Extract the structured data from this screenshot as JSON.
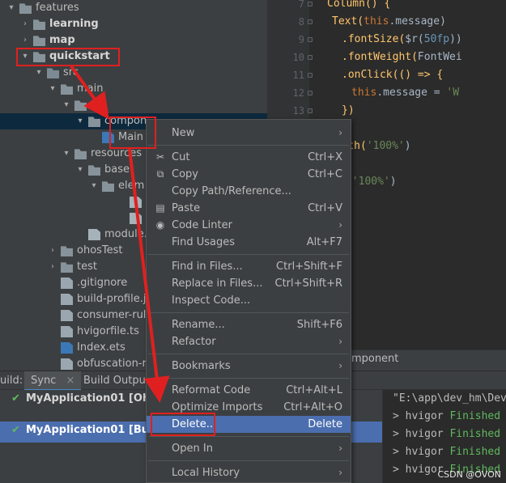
{
  "tree": {
    "rows": [
      {
        "label": "features",
        "type": "folder",
        "chev": "▾",
        "depth": 0
      },
      {
        "label": "learning",
        "type": "module",
        "chev": "›",
        "depth": 1
      },
      {
        "label": "map",
        "type": "module",
        "chev": "›",
        "depth": 1
      },
      {
        "label": "quickstart",
        "type": "module",
        "chev": "▾",
        "depth": 1
      },
      {
        "label": "src",
        "type": "src",
        "chev": "▾",
        "depth": 2
      },
      {
        "label": "main",
        "type": "folder",
        "chev": "▾",
        "depth": 3
      },
      {
        "label": "ets",
        "type": "folder",
        "chev": "▾",
        "depth": 4
      },
      {
        "label": "compon",
        "type": "folder",
        "chev": "▾",
        "depth": 5
      },
      {
        "label": "Main",
        "type": "ets",
        "chev": "",
        "depth": 6
      },
      {
        "label": "resources",
        "type": "folder",
        "chev": "▾",
        "depth": 4
      },
      {
        "label": "base",
        "type": "folder",
        "chev": "▾",
        "depth": 5
      },
      {
        "label": "elem",
        "type": "folder",
        "chev": "▾",
        "depth": 6
      },
      {
        "label": "flo",
        "type": "json",
        "chev": "",
        "depth": 8
      },
      {
        "label": "str",
        "type": "json",
        "chev": "",
        "depth": 8
      },
      {
        "label": "module.jso",
        "type": "json",
        "chev": "",
        "depth": 5
      },
      {
        "label": "ohosTest",
        "type": "folder",
        "chev": "›",
        "depth": 3
      },
      {
        "label": "test",
        "type": "folder",
        "chev": "›",
        "depth": 3
      },
      {
        "label": ".gitignore",
        "type": "file",
        "chev": "",
        "depth": 3
      },
      {
        "label": "build-profile.jso",
        "type": "file",
        "chev": "",
        "depth": 3
      },
      {
        "label": "consumer-rules.t",
        "type": "file",
        "chev": "",
        "depth": 3
      },
      {
        "label": "hvigorfile.ts",
        "type": "file",
        "chev": "",
        "depth": 3
      },
      {
        "label": "Index.ets",
        "type": "ets",
        "chev": "",
        "depth": 3
      },
      {
        "label": "obfuscation-rules",
        "type": "file",
        "chev": "",
        "depth": 3
      }
    ]
  },
  "editor": {
    "line_numbers": [
      "7",
      "8",
      "9",
      "10",
      "11",
      "12",
      "13"
    ],
    "lines": [
      [
        {
          "t": "Column() {",
          "c": "c-y",
          "i": 4
        }
      ],
      [
        {
          "t": "Text(",
          "c": "c-y",
          "i": 5
        },
        {
          "t": "this",
          "c": "c-o"
        },
        {
          "t": ".message)",
          "c": ""
        }
      ],
      [
        {
          "t": ".fontSize(",
          "c": "c-y",
          "i": 7
        },
        {
          "t": "$r(",
          "c": ""
        },
        {
          "t": "50fp",
          "c": "c-b"
        },
        {
          "t": "))",
          "c": ""
        }
      ],
      [
        {
          "t": ".fontWeight(",
          "c": "c-y",
          "i": 7
        },
        {
          "t": "FontWei",
          "c": ""
        }
      ],
      [
        {
          "t": ".onClick(() => {",
          "c": "c-y",
          "i": 7
        }
      ],
      [
        {
          "t": "this",
          "c": "c-o",
          "i": 9
        },
        {
          "t": ".message = ",
          "c": ""
        },
        {
          "t": "'W",
          "c": "c-g"
        }
      ],
      [
        {
          "t": "})",
          "c": "c-y",
          "i": 7
        }
      ],
      [
        {
          "t": "}",
          "c": "c-y",
          "i": 3
        }
      ],
      [
        {
          "t": ".width(",
          "c": "c-y",
          "i": 3
        },
        {
          "t": "'100%'",
          "c": "c-g"
        },
        {
          "t": ")",
          "c": ""
        }
      ],
      [
        {
          "t": "",
          "c": "",
          "i": 0
        }
      ],
      [
        {
          "t": "height(",
          "c": "c-y",
          "i": 0
        },
        {
          "t": "'100%'",
          "c": "c-g"
        },
        {
          "t": ")",
          "c": ""
        }
      ]
    ],
    "breadcrumb_fragment": "omponent"
  },
  "tabs": {
    "build_label": "uild:",
    "sync_label": "Sync",
    "close_glyph": "×",
    "build_output_label": "Build Output"
  },
  "build": {
    "rows": [
      {
        "label": "MyApplication01 [Ohpm"
      },
      {
        "label": "MyApplication01 [Build"
      }
    ]
  },
  "console": {
    "lines": [
      {
        "a": "\"E:\\app\\dev_hm\\Dev",
        "b": ""
      },
      {
        "a": "> hvigor ",
        "b": "Finished"
      },
      {
        "a": "> hvigor ",
        "b": "Finished"
      },
      {
        "a": "> hvigor ",
        "b": "Finished"
      },
      {
        "a": "> hvigor ",
        "b": "Finished"
      }
    ]
  },
  "menu": {
    "items": [
      {
        "label": "New",
        "shortcut": "",
        "sub": true,
        "icon": ""
      },
      {
        "sep": true
      },
      {
        "label": "Cut",
        "shortcut": "Ctrl+X",
        "icon": "✂"
      },
      {
        "label": "Copy",
        "shortcut": "Ctrl+C",
        "icon": "⧉"
      },
      {
        "label": "Copy Path/Reference...",
        "shortcut": "",
        "icon": ""
      },
      {
        "label": "Paste",
        "shortcut": "Ctrl+V",
        "icon": "▤"
      },
      {
        "label": "Code Linter",
        "shortcut": "",
        "sub": true,
        "icon": "◉"
      },
      {
        "label": "Find Usages",
        "shortcut": "Alt+F7",
        "icon": ""
      },
      {
        "sep": true
      },
      {
        "label": "Find in Files...",
        "shortcut": "Ctrl+Shift+F",
        "icon": ""
      },
      {
        "label": "Replace in Files...",
        "shortcut": "Ctrl+Shift+R",
        "icon": ""
      },
      {
        "label": "Inspect Code...",
        "shortcut": "",
        "icon": ""
      },
      {
        "sep": true
      },
      {
        "label": "Rename...",
        "shortcut": "Shift+F6",
        "icon": ""
      },
      {
        "label": "Refactor",
        "shortcut": "",
        "sub": true,
        "icon": ""
      },
      {
        "sep": true
      },
      {
        "label": "Bookmarks",
        "shortcut": "",
        "sub": true,
        "icon": ""
      },
      {
        "sep": true
      },
      {
        "label": "Reformat Code",
        "shortcut": "Ctrl+Alt+L",
        "icon": "≡"
      },
      {
        "label": "Optimize Imports",
        "shortcut": "Ctrl+Alt+O",
        "icon": ""
      },
      {
        "label": "Delete...",
        "shortcut": "Delete",
        "icon": "",
        "highlight": true
      },
      {
        "sep": true
      },
      {
        "label": "Open In",
        "shortcut": "",
        "sub": true,
        "icon": ""
      },
      {
        "sep": true
      },
      {
        "label": "Local History",
        "shortcut": "",
        "sub": true,
        "icon": ""
      }
    ]
  },
  "watermark": "CSDN @OVON",
  "colors": {
    "annotation_red": "#e02020",
    "selection_blue": "#4b6eaf",
    "success_green": "#5fb85f"
  }
}
